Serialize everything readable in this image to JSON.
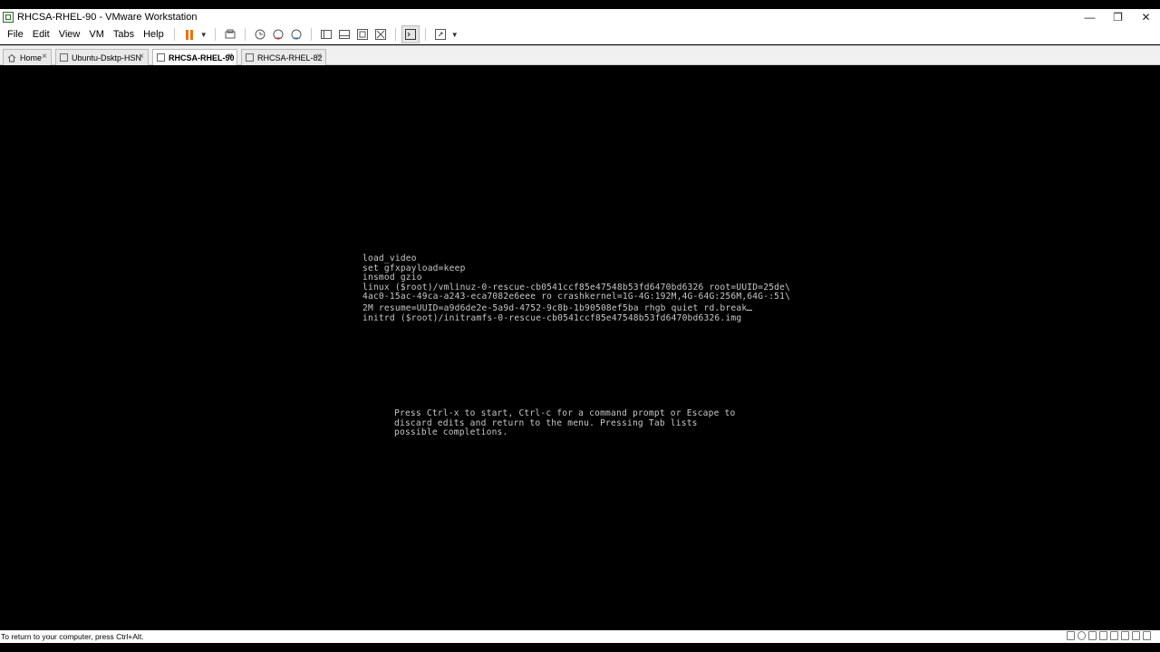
{
  "window": {
    "title": "RHCSA-RHEL-90 - VMware Workstation",
    "controls": {
      "minimize": "—",
      "restore": "❐",
      "close": "✕"
    }
  },
  "menu": {
    "items": [
      "File",
      "Edit",
      "View",
      "VM",
      "Tabs",
      "Help"
    ]
  },
  "toolbar": {
    "icons": [
      "pause-icon",
      "send-ctrl-alt-del-icon",
      "snapshot-icon",
      "revert-snapshot-icon",
      "manage-snapshots-icon",
      "library-icon",
      "thumbnail-icon",
      "full-screen-icon",
      "unity-icon",
      "console-view-icon",
      "stretch-guest-icon"
    ],
    "accent": "#e8730e"
  },
  "tabs": [
    {
      "label": "Home",
      "active": false
    },
    {
      "label": "Ubuntu-Dsktp-HSN",
      "active": false
    },
    {
      "label": "RHCSA-RHEL-90",
      "active": true
    },
    {
      "label": "RHCSA-RHEL-82",
      "active": false
    }
  ],
  "console": {
    "grub_lines": [
      "load_video",
      "set gfxpayload=keep",
      "insmod gzio",
      "linux ($root)/vmlinuz-0-rescue-cb0541ccf85e47548b53fd6470bd6326 root=UUID=25de\\",
      "4ac0-15ac-49ca-a243-eca7082e6eee ro crashkernel=1G-4G:192M,4G-64G:256M,64G-:51\\",
      "2M resume=UUID=a9d6de2e-5a9d-4752-9c8b-1b90508ef5ba rhgb quiet rd.break",
      "initrd ($root)/initramfs-0-rescue-cb0541ccf85e47548b53fd6470bd6326.img"
    ],
    "help_lines": [
      "Press Ctrl-x to start, Ctrl-c for a command prompt or Escape to",
      "discard edits and return to the menu. Pressing Tab lists",
      "possible completions."
    ],
    "text_color": "#c8c8c8",
    "background": "#000000"
  },
  "status": {
    "text": "To return to your computer, press Ctrl+Alt.",
    "device_icons": [
      "hard-disk-icon",
      "cd-icon",
      "network-icon",
      "usb-icon",
      "printer-icon",
      "sound-icon",
      "display-icon",
      "message-icon"
    ]
  }
}
